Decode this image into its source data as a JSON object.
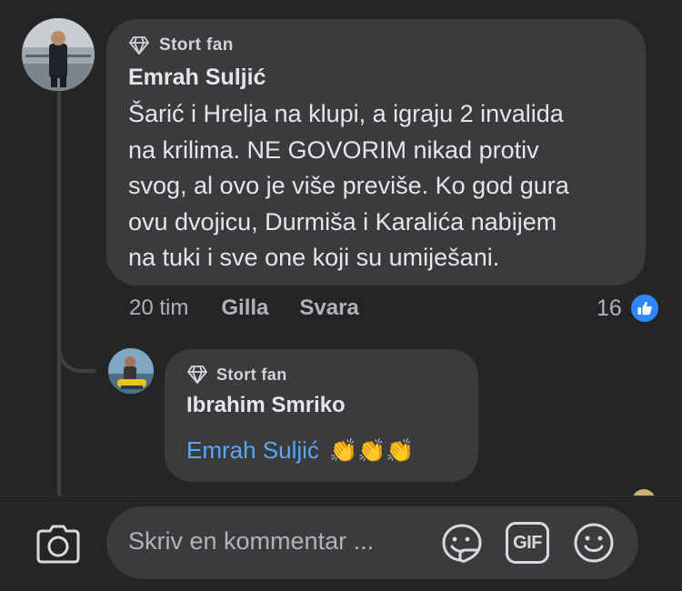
{
  "comment": {
    "badge": "Stort fan",
    "author": "Emrah Suljić",
    "text_lines": [
      "Šarić i Hrelja na klupi, a igraju 2 invalida",
      "na krilima. NE GOVORIM nikad protiv",
      "svog, al ovo je više previše. Ko god gura",
      "ovu dvojicu, Durmiša i Karalića nabijem",
      "na tuki i sve one koji su umiješani."
    ],
    "time": "20 tim",
    "like_label": "Gilla",
    "reply_label": "Svara",
    "reaction_count": "16"
  },
  "reply": {
    "badge": "Stort fan",
    "author": "Ibrahim Smriko",
    "mention": "Emrah Suljić",
    "emoji": "👏👏👏"
  },
  "composer": {
    "placeholder": "Skriv en kommentar ...",
    "camera_icon": "camera-icon",
    "sticker_icon": "sticker-icon",
    "gif_label": "GIF",
    "emoji_icon": "smiley-icon"
  },
  "colors": {
    "background": "#242526",
    "bubble": "#3a3b3c",
    "mention": "#5aa7ff",
    "like": "#2d88ff"
  }
}
